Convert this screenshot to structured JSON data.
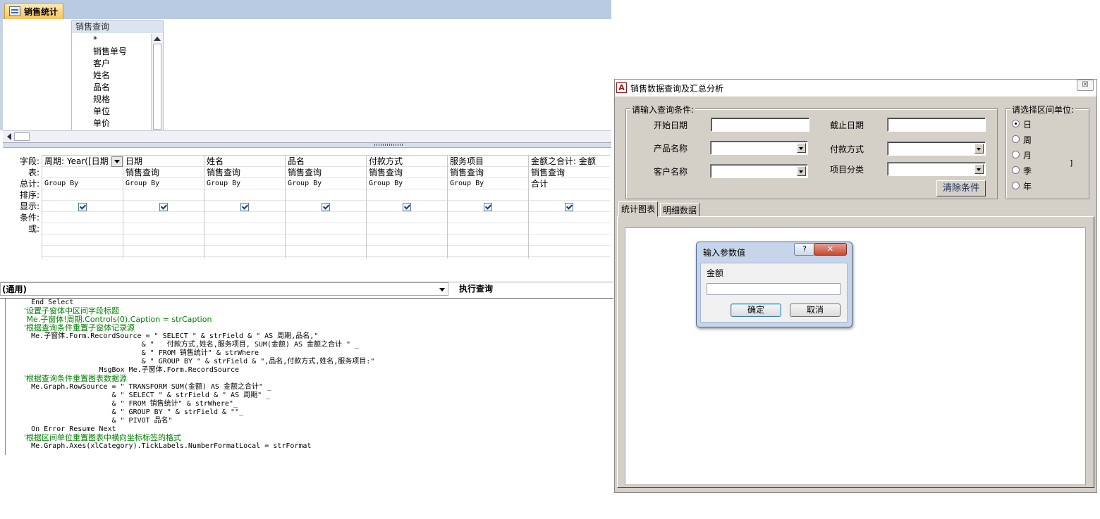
{
  "query_design": {
    "tab_title": "销售统计",
    "field_list": {
      "title": "销售查询",
      "items": [
        "*",
        "销售单号",
        "客户",
        "姓名",
        "品名",
        "规格",
        "单位",
        "单价"
      ]
    },
    "grid": {
      "row_labels": [
        "字段:",
        "表:",
        "总计:",
        "排序:",
        "显示:",
        "条件:",
        "或:"
      ],
      "columns": [
        {
          "field": "周期: Year([日期",
          "table": "",
          "total": "Group By"
        },
        {
          "field": "日期",
          "table": "销售查询",
          "total": "Group By"
        },
        {
          "field": "姓名",
          "table": "销售查询",
          "total": "Group By"
        },
        {
          "field": "品名",
          "table": "销售查询",
          "total": "Group By"
        },
        {
          "field": "付款方式",
          "table": "销售查询",
          "total": "Group By"
        },
        {
          "field": "服务项目",
          "table": "销售查询",
          "total": "Group By"
        },
        {
          "field": "金额之合计: 金额",
          "table": "销售查询",
          "total": "合计"
        }
      ]
    }
  },
  "code_window": {
    "object_combo": "(通用)",
    "procedure_combo": "执行查询",
    "lines": [
      {
        "text": "    End Select",
        "comment": false
      },
      {
        "text": "    '设置子窗体中区间字段标题",
        "comment": true
      },
      {
        "text": "     Me.子窗体!周期.Controls(0).Caption = strCaption",
        "comment": true
      },
      {
        "text": "    '根据查询条件重置子窗体记录源",
        "comment": true
      },
      {
        "text": "    Me.子窗体.Form.RecordSource = \" SELECT \" & strField & \" AS 周期,品名,\"",
        "comment": false
      },
      {
        "text": "                              & \"   付款方式,姓名,服务项目, SUM(金额) AS 金额之合计 \" _",
        "comment": false
      },
      {
        "text": "                              & \" FROM 销售统计\" & strWhere",
        "comment": false
      },
      {
        "text": "                              & \" GROUP BY \" & strField & \",品名,付款方式,姓名,服务项目:\"",
        "comment": false
      },
      {
        "text": "                    MsgBox Me.子窗体.Form.RecordSource",
        "comment": false
      },
      {
        "text": "    '根据查询条件重置图表数据源",
        "comment": true
      },
      {
        "text": "    Me.Graph.RowSource = \" TRANSFORM SUM(金额) AS 金额之合计\" _",
        "comment": false
      },
      {
        "text": "                       & \" SELECT \" & strField & \" AS 周期\" _",
        "comment": false
      },
      {
        "text": "                       & \" FROM 销售统计\" & strWhere\"_",
        "comment": false
      },
      {
        "text": "                       & \" GROUP BY \" & strField & \"\"_",
        "comment": false
      },
      {
        "text": "                       & \" PIVOT 品名\"",
        "comment": false
      },
      {
        "text": "    On Error Resume Next",
        "comment": false
      },
      {
        "text": "    '根据区间单位重置图表中横向坐标标签的格式",
        "comment": true
      },
      {
        "text": "    Me.Graph.Axes(xlCategory).TickLabels.NumberFormatLocal = strFormat",
        "comment": false
      }
    ]
  },
  "form": {
    "title": "销售数据查询及汇总分析",
    "close_glyph": "☒",
    "query_group": {
      "title": "请输入查询条件:",
      "start_date_label": "开始日期",
      "end_date_label": "截止日期",
      "product_label": "产品名称",
      "payment_label": "付款方式",
      "customer_label": "客户名称",
      "category_label": "项目分类",
      "clear_button": "清除条件"
    },
    "interval_group": {
      "title": "请选择区间单位:",
      "options": [
        "日",
        "周",
        "月",
        "季",
        "年"
      ],
      "selected": "日"
    },
    "tabs": [
      "统计图表",
      "明细数据"
    ],
    "active_tab": "统计图表"
  },
  "param_dialog": {
    "title": "输入参数值",
    "help_glyph": "?",
    "close_glyph": "✕",
    "prompt": "金额",
    "value": "",
    "ok_label": "确定",
    "cancel_label": "取消"
  }
}
